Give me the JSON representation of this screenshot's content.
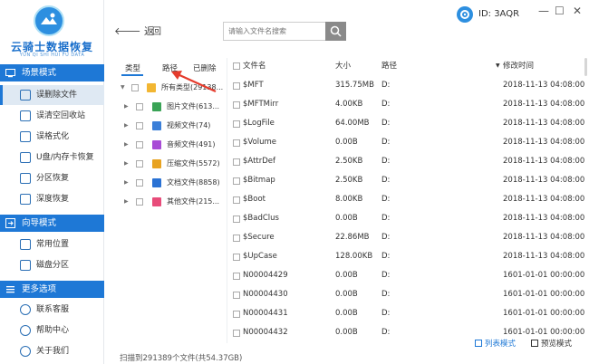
{
  "colors": {
    "accent": "#1e78d6",
    "sidebar_active": "#dfe9f3",
    "arrow": "#e53b2c"
  },
  "logo": {
    "title": "云骑士数据恢复",
    "subtitle": "YUN QI SHI HUI FU DATA"
  },
  "sidebar": {
    "sections": [
      {
        "label": "场景模式",
        "icon": "scene-icon"
      },
      {
        "label": "向导模式",
        "icon": "wizard-icon"
      },
      {
        "label": "更多选项",
        "icon": "menu-icon"
      }
    ],
    "scene_items": [
      {
        "label": "误删除文件",
        "icon": "delete-file-icon",
        "active": true
      },
      {
        "label": "误清空回收站",
        "icon": "recycle-bin-icon"
      },
      {
        "label": "误格式化",
        "icon": "format-icon"
      },
      {
        "label": "U盘/内存卡恢复",
        "icon": "usb-icon"
      },
      {
        "label": "分区恢复",
        "icon": "partition-icon"
      },
      {
        "label": "深度恢复",
        "icon": "deep-recovery-icon"
      }
    ],
    "wizard_items": [
      {
        "label": "常用位置",
        "icon": "location-icon"
      },
      {
        "label": "磁盘分区",
        "icon": "disk-icon"
      }
    ],
    "more_items": [
      {
        "label": "联系客服",
        "icon": "support-icon"
      },
      {
        "label": "帮助中心",
        "icon": "help-icon"
      },
      {
        "label": "关于我们",
        "icon": "about-icon"
      }
    ]
  },
  "topbar": {
    "back_label": "返",
    "home_label": "回",
    "search_placeholder": "请输入文件名搜索",
    "id_label": "ID: 3AQR",
    "minimize": "—",
    "maximize": "☐",
    "close": "✕"
  },
  "left_tabs": [
    {
      "label": "类型",
      "active": true
    },
    {
      "label": "路径"
    },
    {
      "label": "已删除"
    }
  ],
  "tree": [
    {
      "label": "所有类型(29138...",
      "icon_color": "#f2b632",
      "root": true
    },
    {
      "label": "图片文件(613...",
      "icon_color": "#3aa356"
    },
    {
      "label": "视频文件(74)",
      "icon_color": "#3b7fd8"
    },
    {
      "label": "音频文件(491)",
      "icon_color": "#a84bd6"
    },
    {
      "label": "压缩文件(5572)",
      "icon_color": "#e8a321"
    },
    {
      "label": "文档文件(8858)",
      "icon_color": "#2a72d4"
    },
    {
      "label": "其他文件(215...",
      "icon_color": "#e84c7a"
    }
  ],
  "table": {
    "headers": {
      "name": "文件名",
      "size": "大小",
      "path": "路径",
      "modified": "修改时间"
    },
    "rows": [
      {
        "name": "$MFT",
        "size": "315.75MB",
        "path": "D:",
        "date": "2018-11-13 04:08:00"
      },
      {
        "name": "$MFTMirr",
        "size": "4.00KB",
        "path": "D:",
        "date": "2018-11-13 04:08:00"
      },
      {
        "name": "$LogFile",
        "size": "64.00MB",
        "path": "D:",
        "date": "2018-11-13 04:08:00"
      },
      {
        "name": "$Volume",
        "size": "0.00B",
        "path": "D:",
        "date": "2018-11-13 04:08:00"
      },
      {
        "name": "$AttrDef",
        "size": "2.50KB",
        "path": "D:",
        "date": "2018-11-13 04:08:00"
      },
      {
        "name": "$Bitmap",
        "size": "2.50KB",
        "path": "D:",
        "date": "2018-11-13 04:08:00"
      },
      {
        "name": "$Boot",
        "size": "8.00KB",
        "path": "D:",
        "date": "2018-11-13 04:08:00"
      },
      {
        "name": "$BadClus",
        "size": "0.00B",
        "path": "D:",
        "date": "2018-11-13 04:08:00"
      },
      {
        "name": "$Secure",
        "size": "22.86MB",
        "path": "D:",
        "date": "2018-11-13 04:08:00"
      },
      {
        "name": "$UpCase",
        "size": "128.00KB",
        "path": "D:",
        "date": "2018-11-13 04:08:00"
      },
      {
        "name": "N00004429",
        "size": "0.00B",
        "path": "D:",
        "date": "1601-01-01 00:00:00"
      },
      {
        "name": "N00004430",
        "size": "0.00B",
        "path": "D:",
        "date": "1601-01-01 00:00:00"
      },
      {
        "name": "N00004431",
        "size": "0.00B",
        "path": "D:",
        "date": "1601-01-01 00:00:00"
      },
      {
        "name": "N00004432",
        "size": "0.00B",
        "path": "D:",
        "date": "1601-01-01 00:00:00"
      }
    ]
  },
  "status": "扫描到291389个文件(共54.37GB)",
  "view_modes": [
    {
      "label": "列表模式",
      "active": true
    },
    {
      "label": "预览模式"
    }
  ]
}
